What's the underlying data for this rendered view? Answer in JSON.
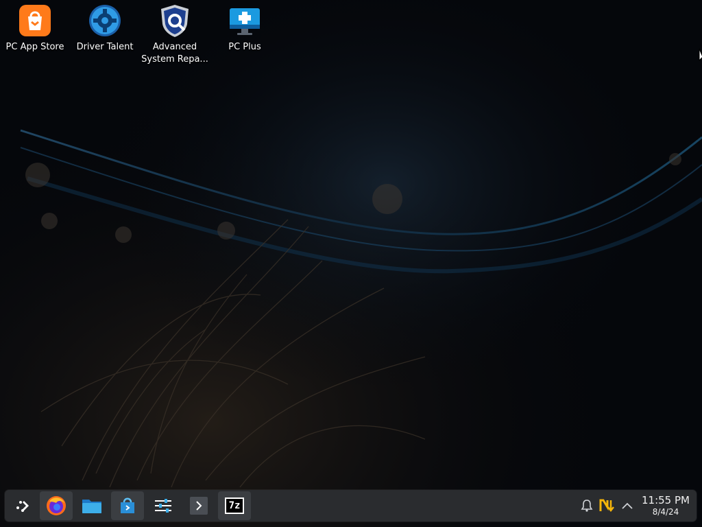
{
  "desktop": {
    "icons": [
      {
        "label": "PC App Store",
        "icon": "shopping-bag-icon"
      },
      {
        "label": "Driver Talent",
        "icon": "gear-icon"
      },
      {
        "label": "Advanced System Repa...",
        "icon": "shield-gear-icon"
      },
      {
        "label": "PC Plus",
        "icon": "monitor-plus-icon"
      }
    ]
  },
  "taskbar": {
    "launcher": {
      "icon": "app-launcher-icon"
    },
    "apps": [
      {
        "name": "Firefox",
        "icon": "firefox-icon"
      },
      {
        "name": "File Manager",
        "icon": "folder-icon"
      },
      {
        "name": "Discover",
        "icon": "store-bag-icon"
      },
      {
        "name": "System Settings",
        "icon": "settings-sliders-icon"
      },
      {
        "name": "Terminal",
        "icon": "terminal-icon"
      },
      {
        "name": "7-Zip",
        "icon": "seven-zip-icon",
        "badge": "7z"
      }
    ],
    "tray": [
      {
        "icon": "notification-bell-icon"
      },
      {
        "icon": "updates-icon"
      },
      {
        "icon": "chevron-up-icon"
      }
    ],
    "clock": {
      "time": "11:55 PM",
      "date": "8/4/24"
    }
  },
  "colors": {
    "taskbar_bg": "#2a2c2f",
    "accent_blue": "#2f9be6",
    "store_orange": "#ff7a1a"
  }
}
